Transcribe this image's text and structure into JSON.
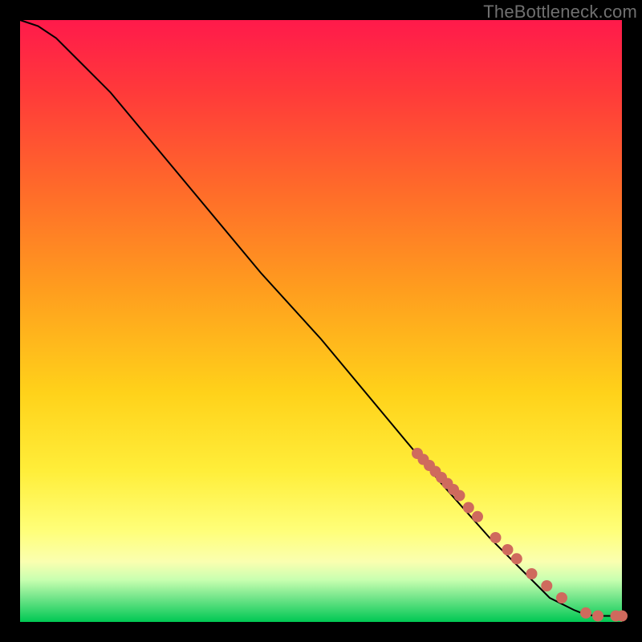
{
  "watermark": "TheBottleneck.com",
  "chart_data": {
    "type": "line",
    "title": "",
    "xlabel": "",
    "ylabel": "",
    "xlim": [
      0,
      100
    ],
    "ylim": [
      0,
      100
    ],
    "grid": false,
    "series": [
      {
        "name": "curve",
        "x": [
          0,
          3,
          6,
          10,
          15,
          20,
          30,
          40,
          50,
          60,
          70,
          78,
          82,
          86,
          88,
          90,
          92,
          94,
          96,
          100
        ],
        "y": [
          100,
          99,
          97,
          93,
          88,
          82,
          70,
          58,
          47,
          35,
          23,
          14,
          10,
          6,
          4,
          3,
          2,
          1.2,
          1,
          1
        ]
      }
    ],
    "markers": {
      "name": "highlighted-points",
      "color": "#cf6a5d",
      "x": [
        66,
        67,
        68,
        69,
        70,
        71,
        72,
        73,
        74.5,
        76,
        79,
        81,
        82.5,
        85,
        87.5,
        90,
        94,
        96,
        99,
        100
      ],
      "y": [
        28,
        27,
        26,
        25,
        24,
        23,
        22,
        21,
        19,
        17.5,
        14,
        12,
        10.5,
        8,
        6,
        4,
        1.5,
        1,
        1,
        1
      ]
    }
  }
}
